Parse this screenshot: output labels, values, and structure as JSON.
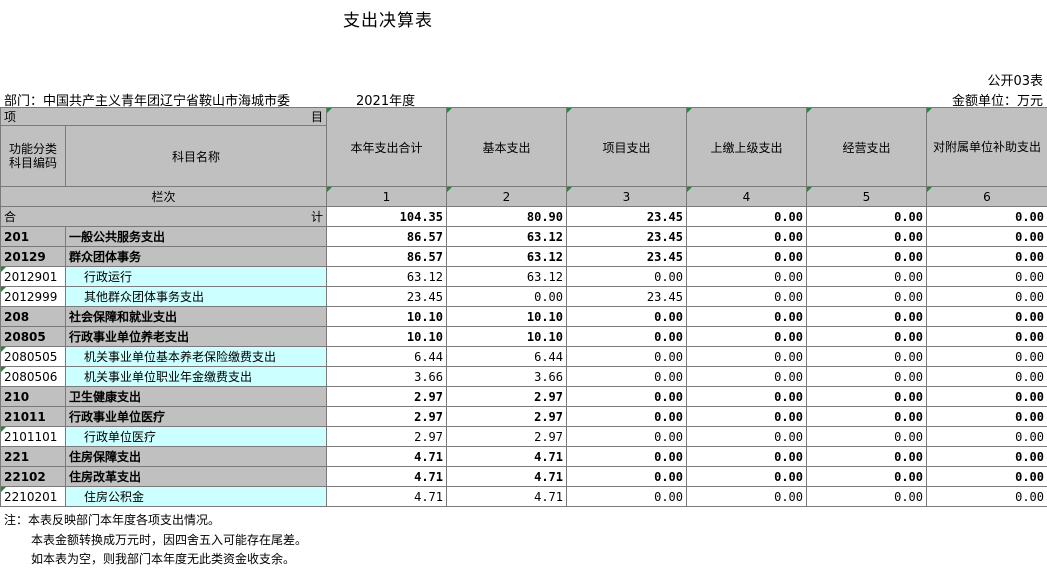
{
  "title": "支出决算表",
  "table_no": "公开03表",
  "department": "部门：中国共产主义青年团辽宁省鞍山市海城市委",
  "year": "2021年度",
  "unit": "金额单位：万元",
  "header": {
    "xiang": "项",
    "mu": "目",
    "func_code": "功能分类科目编码",
    "subject_name": "科目名称",
    "columns": [
      "本年支出合计",
      "基本支出",
      "项目支出",
      "上缴上级支出",
      "经营支出",
      "对附属单位补助支出"
    ],
    "lanci": "栏次",
    "col_nums": [
      "1",
      "2",
      "3",
      "4",
      "5",
      "6"
    ]
  },
  "total": {
    "he": "合",
    "ji": "计",
    "values": [
      "104.35",
      "80.90",
      "23.45",
      "0.00",
      "0.00",
      "0.00"
    ]
  },
  "rows": [
    {
      "code": "201",
      "name": "一般公共服务支出",
      "level": 1,
      "values": [
        "86.57",
        "63.12",
        "23.45",
        "0.00",
        "0.00",
        "0.00"
      ]
    },
    {
      "code": "20129",
      "name": "群众团体事务",
      "level": 2,
      "values": [
        "86.57",
        "63.12",
        "23.45",
        "0.00",
        "0.00",
        "0.00"
      ]
    },
    {
      "code": "2012901",
      "name": "行政运行",
      "level": 3,
      "values": [
        "63.12",
        "63.12",
        "0.00",
        "0.00",
        "0.00",
        "0.00"
      ]
    },
    {
      "code": "2012999",
      "name": "其他群众团体事务支出",
      "level": 3,
      "values": [
        "23.45",
        "0.00",
        "23.45",
        "0.00",
        "0.00",
        "0.00"
      ]
    },
    {
      "code": "208",
      "name": "社会保障和就业支出",
      "level": 1,
      "values": [
        "10.10",
        "10.10",
        "0.00",
        "0.00",
        "0.00",
        "0.00"
      ]
    },
    {
      "code": "20805",
      "name": "行政事业单位养老支出",
      "level": 2,
      "values": [
        "10.10",
        "10.10",
        "0.00",
        "0.00",
        "0.00",
        "0.00"
      ]
    },
    {
      "code": "2080505",
      "name": "机关事业单位基本养老保险缴费支出",
      "level": 3,
      "values": [
        "6.44",
        "6.44",
        "0.00",
        "0.00",
        "0.00",
        "0.00"
      ]
    },
    {
      "code": "2080506",
      "name": "机关事业单位职业年金缴费支出",
      "level": 3,
      "values": [
        "3.66",
        "3.66",
        "0.00",
        "0.00",
        "0.00",
        "0.00"
      ]
    },
    {
      "code": "210",
      "name": "卫生健康支出",
      "level": 1,
      "values": [
        "2.97",
        "2.97",
        "0.00",
        "0.00",
        "0.00",
        "0.00"
      ]
    },
    {
      "code": "21011",
      "name": "行政事业单位医疗",
      "level": 2,
      "values": [
        "2.97",
        "2.97",
        "0.00",
        "0.00",
        "0.00",
        "0.00"
      ]
    },
    {
      "code": "2101101",
      "name": "行政单位医疗",
      "level": 3,
      "values": [
        "2.97",
        "2.97",
        "0.00",
        "0.00",
        "0.00",
        "0.00"
      ]
    },
    {
      "code": "221",
      "name": "住房保障支出",
      "level": 1,
      "values": [
        "4.71",
        "4.71",
        "0.00",
        "0.00",
        "0.00",
        "0.00"
      ]
    },
    {
      "code": "22102",
      "name": "住房改革支出",
      "level": 2,
      "values": [
        "4.71",
        "4.71",
        "0.00",
        "0.00",
        "0.00",
        "0.00"
      ]
    },
    {
      "code": "2210201",
      "name": "住房公积金",
      "level": 3,
      "values": [
        "4.71",
        "4.71",
        "0.00",
        "0.00",
        "0.00",
        "0.00"
      ]
    }
  ],
  "notes": [
    "注：本表反映部门本年度各项支出情况。",
    "本表金额转换成万元时，因四舍五入可能存在尾差。",
    "如本表为空，则我部门本年度无此类资金收支余。"
  ],
  "colors": {
    "gray": "#c0c0c0",
    "cyan": "#ccffff",
    "marker": "#1a8c3a"
  }
}
